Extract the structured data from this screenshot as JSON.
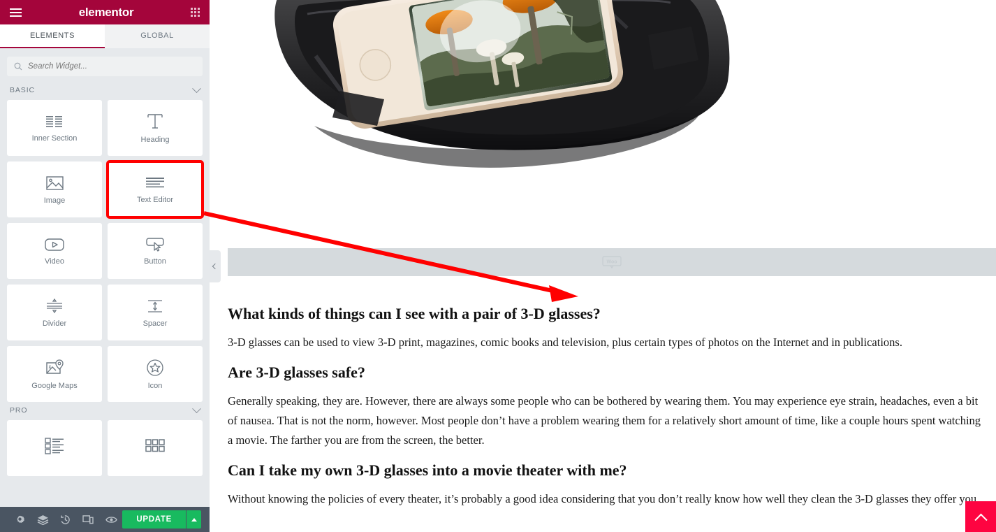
{
  "panel": {
    "header": {
      "logo": "elementor",
      "menu_icon": "hamburger-icon",
      "grid_icon": "apps-grid-icon"
    },
    "tabs": [
      {
        "label": "ELEMENTS",
        "active": true
      },
      {
        "label": "GLOBAL",
        "active": false
      }
    ],
    "search": {
      "placeholder": "Search Widget...",
      "value": "",
      "icon": "search-icon"
    },
    "categories": [
      {
        "name": "BASIC",
        "widgets": [
          {
            "label": "Inner Section",
            "icon": "columns-icon",
            "highlighted": false
          },
          {
            "label": "Heading",
            "icon": "heading-t-icon",
            "highlighted": false
          },
          {
            "label": "Image",
            "icon": "image-icon",
            "highlighted": false
          },
          {
            "label": "Text Editor",
            "icon": "text-lines-icon",
            "highlighted": true
          },
          {
            "label": "Video",
            "icon": "video-play-icon",
            "highlighted": false
          },
          {
            "label": "Button",
            "icon": "button-cursor-icon",
            "highlighted": false
          },
          {
            "label": "Divider",
            "icon": "divider-icon",
            "highlighted": false
          },
          {
            "label": "Spacer",
            "icon": "spacer-arrows-icon",
            "highlighted": false
          },
          {
            "label": "Google Maps",
            "icon": "map-pin-icon",
            "highlighted": false
          },
          {
            "label": "Icon",
            "icon": "star-circle-icon",
            "highlighted": false
          }
        ]
      },
      {
        "name": "PRO",
        "widgets": [
          {
            "label": "",
            "icon": "posts-list-icon",
            "highlighted": false
          },
          {
            "label": "",
            "icon": "gallery-grid-icon",
            "highlighted": false
          }
        ]
      }
    ]
  },
  "toolbar": {
    "icons": [
      {
        "name": "settings-gear-icon",
        "title": "Settings"
      },
      {
        "name": "navigator-layers-icon",
        "title": "Navigator"
      },
      {
        "name": "history-clock-icon",
        "title": "History"
      },
      {
        "name": "responsive-devices-icon",
        "title": "Responsive Mode"
      },
      {
        "name": "preview-eye-icon",
        "title": "Preview Changes"
      }
    ],
    "update_label": "UPDATE",
    "caret_icon": "caret-up-icon"
  },
  "canvas": {
    "collapse_icon": "chevron-left-icon",
    "placeholder_logo": "Woo",
    "scroll_top_icon": "chevron-up-icon",
    "sections": [
      {
        "type": "heading",
        "text": "What kinds of things can I see with a pair of 3-D glasses?"
      },
      {
        "type": "paragraph",
        "text": "3-D glasses can be used to view 3-D print, magazines, comic books and television, plus certain types of photos on the Internet and in publications."
      },
      {
        "type": "heading",
        "text": "Are 3-D glasses safe?"
      },
      {
        "type": "paragraph",
        "text": "Generally speaking, they are. However, there are always some people who can be bothered by wearing them. You may experience eye strain, headaches, even a bit of nausea. That is not the norm, however. Most people don’t have a problem wearing them for a relatively short amount of time, like a couple hours spent watching a movie. The farther you are from the screen, the better."
      },
      {
        "type": "heading",
        "text": "Can I take my own 3-D glasses into a movie theater with me?"
      },
      {
        "type": "paragraph",
        "text": "Without knowing the policies of every theater, it’s probably a good idea considering that you don’t really know how well they clean the 3-D glasses they offer you."
      }
    ]
  },
  "colors": {
    "brand": "#a4053b",
    "panel_bg": "#e6e9ec",
    "toolbar_bg": "#4a5562",
    "update_green": "#18ba5f",
    "annotation_red": "#ff0000",
    "scroll_top_red": "#fe0441"
  }
}
